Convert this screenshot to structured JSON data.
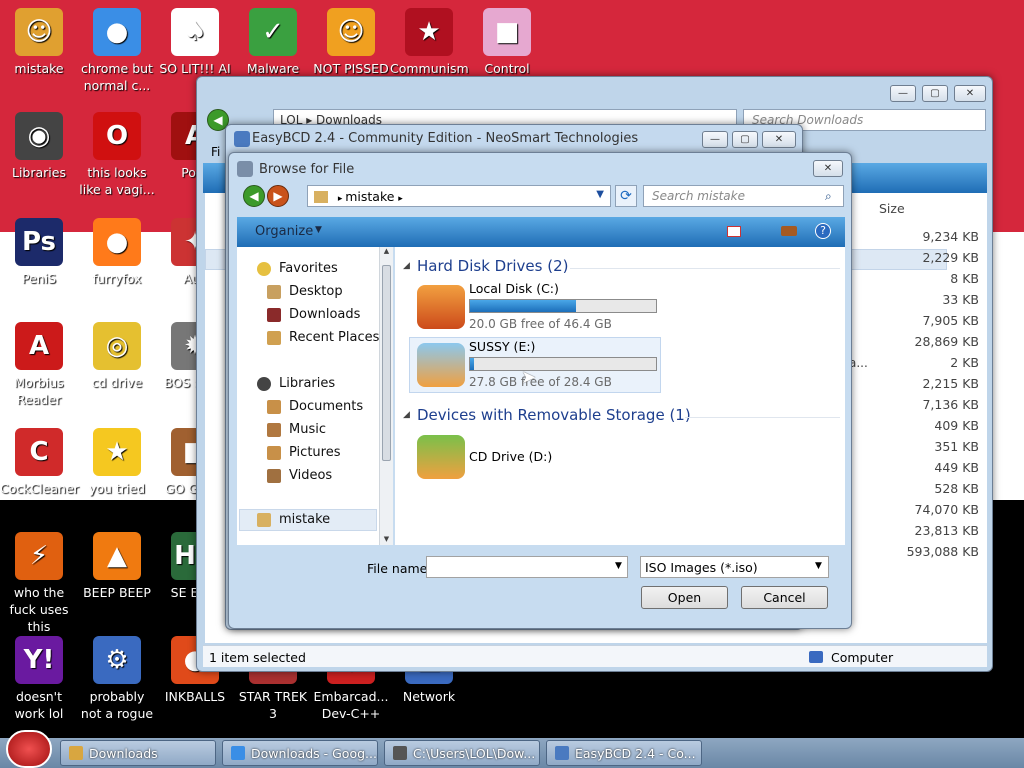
{
  "desktop": {
    "icons": [
      {
        "label": "mistake",
        "glyph": "☺",
        "color": "#e0a030"
      },
      {
        "label": "chrome but normal c...",
        "glyph": "●",
        "color": "#3a8ee6"
      },
      {
        "label": "SO LIT!!! AI",
        "glyph": "♠",
        "color": "#ffffff"
      },
      {
        "label": "Malware",
        "glyph": "✓",
        "color": "#3aa040"
      },
      {
        "label": "NOT PISSED",
        "glyph": "☺",
        "color": "#f0a020"
      },
      {
        "label": "Communism",
        "glyph": "★",
        "color": "#b01020"
      },
      {
        "label": "Control",
        "glyph": "■",
        "color": "#e6a8d0"
      },
      {
        "label": "Libraries",
        "glyph": "◉",
        "color": "#444444"
      },
      {
        "label": "this looks like a vagi...",
        "glyph": "O",
        "color": "#d01010"
      },
      {
        "label": "Porn",
        "glyph": "A",
        "color": "#a01010"
      },
      {
        "label": "PeniS",
        "glyph": "Ps",
        "color": "#1c2a6a"
      },
      {
        "label": "furryfox",
        "glyph": "●",
        "color": "#ff7a1a"
      },
      {
        "label": "Aus",
        "glyph": "✦",
        "color": "#cc3333"
      },
      {
        "label": "Morbius Reader",
        "glyph": "A",
        "color": "#cc1a1a"
      },
      {
        "label": "cd drive",
        "glyph": "◎",
        "color": "#e5c030"
      },
      {
        "label": "BOS SIMU",
        "glyph": "✹",
        "color": "#777777"
      },
      {
        "label": "CockCleaner",
        "glyph": "C",
        "color": "#d02a2a"
      },
      {
        "label": "you tried",
        "glyph": "★",
        "color": "#f5c820"
      },
      {
        "label": "GO GADC",
        "glyph": "■",
        "color": "#a06030"
      },
      {
        "label": "who the fuck uses this",
        "glyph": "⚡",
        "color": "#e06010"
      },
      {
        "label": "BEEP BEEP",
        "glyph": "▲",
        "color": "#f07a10"
      },
      {
        "label": "SE EDIT",
        "glyph": "HX",
        "color": "#2a6a3a"
      },
      {
        "label": "doesn't work lol",
        "glyph": "Y!",
        "color": "#6a1aa0"
      },
      {
        "label": "probably not a rogue",
        "glyph": "⚙",
        "color": "#3a6ac0"
      },
      {
        "label": "INKBALLS",
        "glyph": "●",
        "color": "#e04a1a"
      },
      {
        "label": "STAR TREK 3",
        "glyph": "W",
        "color": "#aa3030"
      },
      {
        "label": "Embarcad... Dev-C++",
        "glyph": "◆",
        "color": "#cc2020"
      },
      {
        "label": "Network",
        "glyph": "■",
        "color": "#3a6ac0"
      }
    ]
  },
  "explorer": {
    "address": "LOL ▸ Downloads",
    "search_placeholder": "Search Downloads",
    "menu_partial": "Fi",
    "size_header": "Size",
    "sizes": [
      "9,234 KB",
      "2,229 KB",
      "8 KB",
      "33 KB",
      "7,905 KB",
      "28,869 KB",
      "2 KB",
      "2,215 KB",
      "7,136 KB",
      "409 KB",
      "351 KB",
      "449 KB",
      "528 KB",
      "74,070 KB",
      "23,813 KB",
      "593,088 KB"
    ],
    "partial_text_row": "a...",
    "status_left": "1 item selected",
    "status_right": "Computer"
  },
  "easybcd": {
    "title": "EasyBCD 2.4 - Community Edition - NeoSmart Technologies"
  },
  "browse": {
    "title": "Browse for File",
    "address_item": "mistake",
    "search_placeholder": "Search mistake",
    "organize_label": "Organize",
    "nav": {
      "favorites": "Favorites",
      "desktop": "Desktop",
      "downloads": "Downloads",
      "recent": "Recent Places",
      "libraries": "Libraries",
      "documents": "Documents",
      "music": "Music",
      "pictures": "Pictures",
      "videos": "Videos",
      "mistake": "mistake"
    },
    "group_hdd": "Hard Disk Drives (2)",
    "group_removable": "Devices with Removable Storage (1)",
    "drives": [
      {
        "name": "Local Disk (C:)",
        "free": "20.0 GB free of 46.4 GB",
        "used_fraction": 0.57
      },
      {
        "name": "SUSSY (E:)",
        "free": "27.8 GB free of 28.4 GB",
        "used_fraction": 0.02
      }
    ],
    "cd_drive": "CD Drive (D:)",
    "file_name_label": "File name:",
    "file_name_value": "",
    "file_type": "ISO Images (*.iso)",
    "open_label": "Open",
    "cancel_label": "Cancel"
  },
  "taskbar": {
    "items": [
      {
        "label": "Downloads",
        "color": "#d8a640"
      },
      {
        "label": "Downloads - Goog...",
        "color": "#3a8ee6"
      },
      {
        "label": "C:\\Users\\LOL\\Dow...",
        "color": "#555555"
      },
      {
        "label": "EasyBCD 2.4 - Co...",
        "color": "#4a7ac0"
      }
    ]
  }
}
